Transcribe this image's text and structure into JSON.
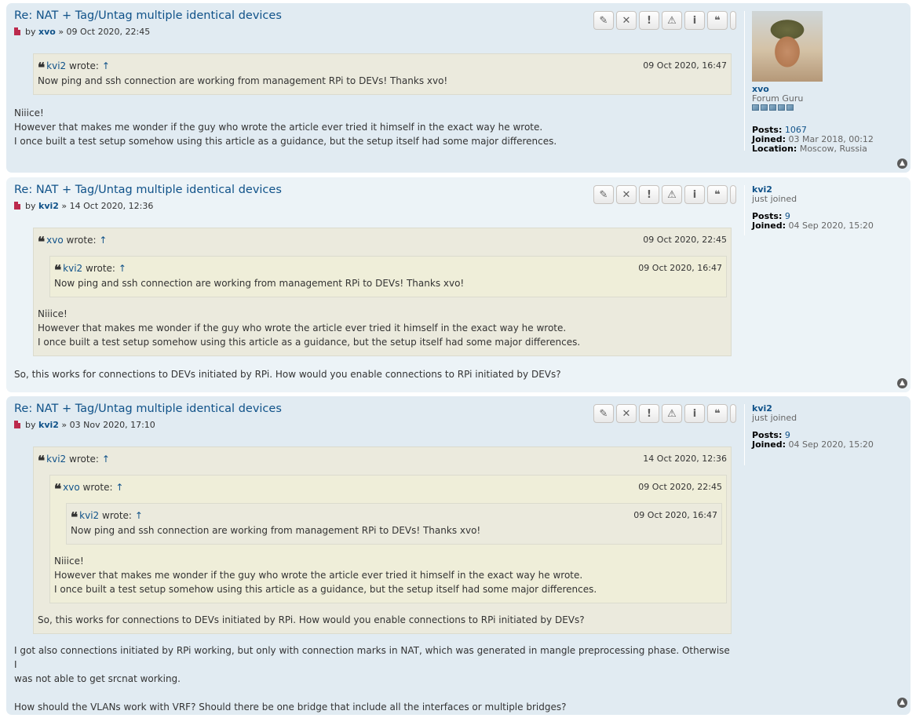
{
  "posts": [
    {
      "title": "Re: NAT + Tag/Untag multiple identical devices",
      "by": "by",
      "author": "xvo",
      "date": "» 09 Oct 2020, 22:45",
      "quote": {
        "user": "kvi2",
        "wrote": "wrote:",
        "arrow": "↑",
        "date": "09 Oct 2020, 16:47",
        "text": "Now ping and ssh connection are working from management RPi to DEVs! Thanks xvo!"
      },
      "body": [
        "Niiice!",
        "However that makes me wonder if the guy who wrote the article ever tried it himself in the exact way he wrote.",
        "I once built a test setup somehow using this article as a guidance, but the setup itself had some major differences."
      ],
      "profile": {
        "name": "xvo",
        "rank": "Forum Guru",
        "posts_label": "Posts:",
        "posts": "1067",
        "joined_label": "Joined:",
        "joined": "03 Mar 2018, 00:12",
        "location_label": "Location:",
        "location": "Moscow, Russia"
      }
    },
    {
      "title": "Re: NAT + Tag/Untag multiple identical devices",
      "by": "by",
      "author": "kvi2",
      "date": "» 14 Oct 2020, 12:36",
      "quote": {
        "user": "xvo",
        "wrote": "wrote:",
        "arrow": "↑",
        "date": "09 Oct 2020, 22:45",
        "inner": {
          "user": "kvi2",
          "wrote": "wrote:",
          "arrow": "↑",
          "date": "09 Oct 2020, 16:47",
          "text": "Now ping and ssh connection are working from management RPi to DEVs! Thanks xvo!"
        },
        "text": [
          "Niiice!",
          "However that makes me wonder if the guy who wrote the article ever tried it himself in the exact way he wrote.",
          "I once built a test setup somehow using this article as a guidance, but the setup itself had some major differences."
        ]
      },
      "body": [
        "So, this works for connections to DEVs initiated by RPi. How would you enable connections to RPi initiated by DEVs?"
      ],
      "profile": {
        "name": "kvi2",
        "rank": "just joined",
        "posts_label": "Posts:",
        "posts": "9",
        "joined_label": "Joined:",
        "joined": "04 Sep 2020, 15:20"
      }
    },
    {
      "title": "Re: NAT + Tag/Untag multiple identical devices",
      "by": "by",
      "author": "kvi2",
      "date": "» 03 Nov 2020, 17:10",
      "quote": {
        "user": "kvi2",
        "wrote": "wrote:",
        "arrow": "↑",
        "date": "14 Oct 2020, 12:36",
        "inner": {
          "user": "xvo",
          "wrote": "wrote:",
          "arrow": "↑",
          "date": "09 Oct 2020, 22:45",
          "inner": {
            "user": "kvi2",
            "wrote": "wrote:",
            "arrow": "↑",
            "date": "09 Oct 2020, 16:47",
            "text": "Now ping and ssh connection are working from management RPi to DEVs! Thanks xvo!"
          },
          "text": [
            "Niiice!",
            "However that makes me wonder if the guy who wrote the article ever tried it himself in the exact way he wrote.",
            "I once built a test setup somehow using this article as a guidance, but the setup itself had some major differences."
          ]
        },
        "text": "So, this works for connections to DEVs initiated by RPi. How would you enable connections to RPi initiated by DEVs?"
      },
      "body": [
        "I got also connections initiated by RPi working, but only with connection marks in NAT, which was generated in mangle preprocessing phase. Otherwise I",
        "was not able to get srcnat working.",
        "",
        "How should the VLANs work with VRF? Should there be one bridge that include all the interfaces or multiple bridges?"
      ],
      "profile": {
        "name": "kvi2",
        "rank": "just joined",
        "posts_label": "Posts:",
        "posts": "9",
        "joined_label": "Joined:",
        "joined": "04 Sep 2020, 15:20"
      }
    }
  ],
  "buttons": {
    "edit": "✎",
    "delete": "✕",
    "report": "!",
    "warn": "⚠",
    "info": "i",
    "quote": "❝"
  },
  "totop_icon": "▲",
  "quote_icon": "❝"
}
